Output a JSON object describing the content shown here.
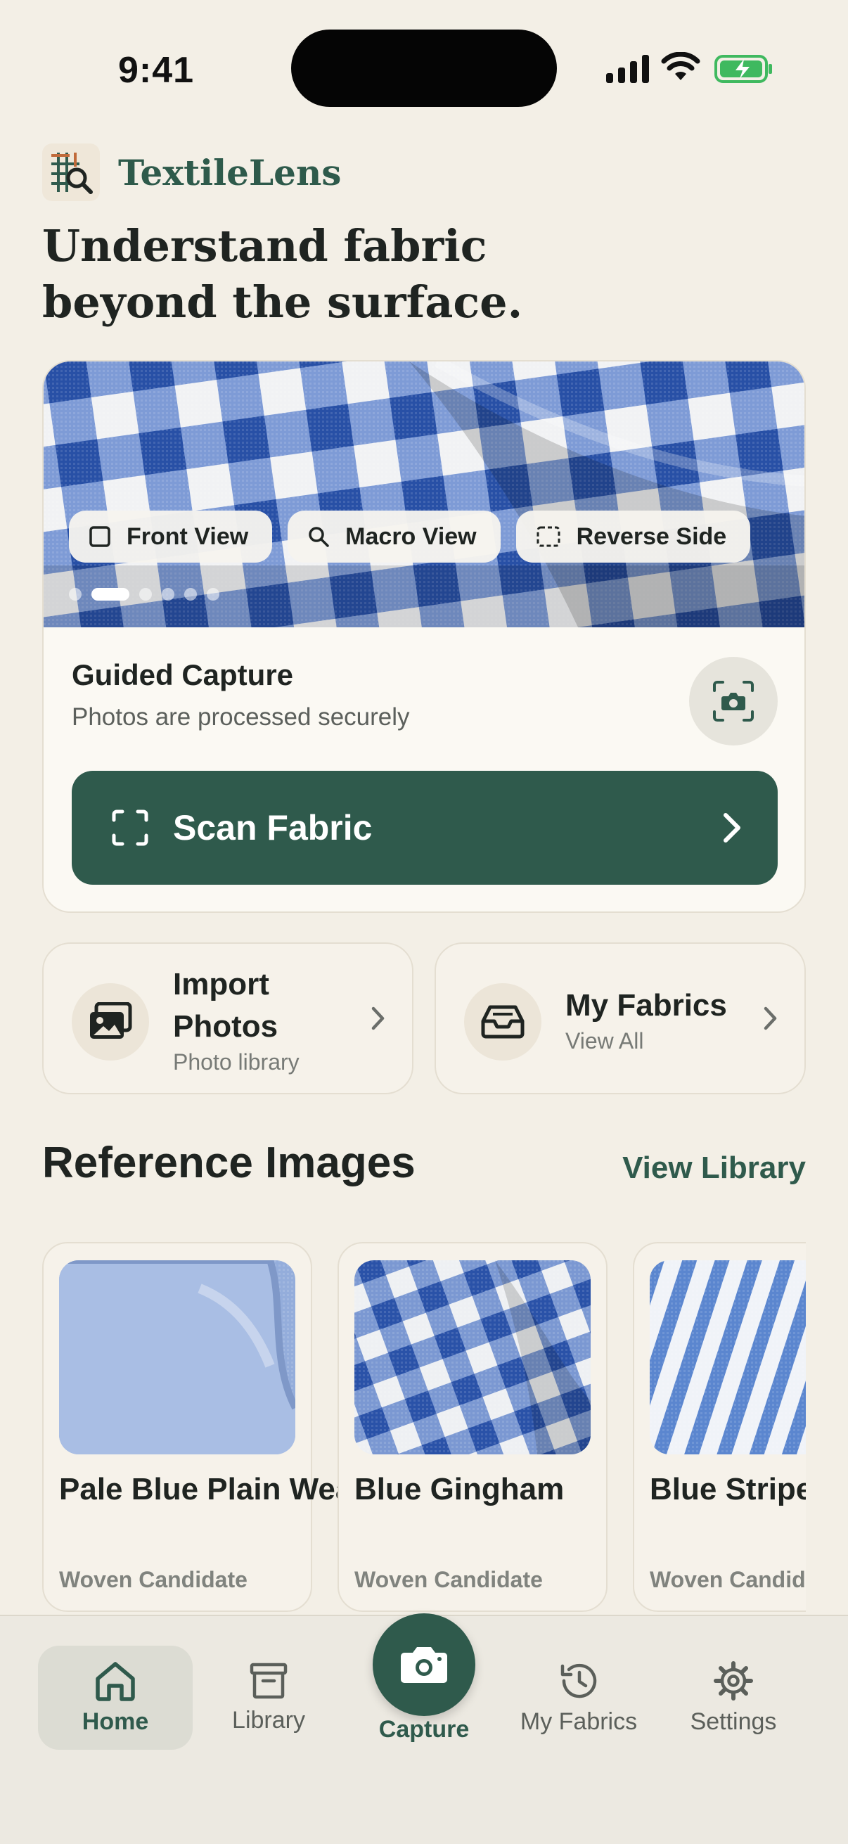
{
  "status_bar": {
    "time": "9:41"
  },
  "app": {
    "name": "TextileLens"
  },
  "headline": "Understand fabric beyond the surface.",
  "guided_card": {
    "chips": [
      {
        "label": "Front View",
        "icon": "square-icon"
      },
      {
        "label": "Macro View",
        "icon": "search-icon"
      },
      {
        "label": "Reverse Side",
        "icon": "dashed-square-icon"
      }
    ],
    "carousel_pages": 6,
    "carousel_active": 2,
    "title": "Guided Capture",
    "subtitle": "Photos are processed securely",
    "scan_button": "Scan Fabric"
  },
  "quick_actions": [
    {
      "title": "Import Photos",
      "subtitle": "Photo library",
      "icon": "photos-icon"
    },
    {
      "title": "My Fabrics",
      "subtitle": "View All",
      "icon": "inbox-icon"
    }
  ],
  "reference_section": {
    "title": "Reference Images",
    "link": "View Library",
    "items": [
      {
        "name": "Pale Blue Plain Weave",
        "kind": "Woven Candidate"
      },
      {
        "name": "Blue Gingham",
        "kind": "Woven Candidate"
      },
      {
        "name": "Blue Stripe Plain Weave",
        "kind": "Woven Candidate"
      }
    ]
  },
  "tab_bar": {
    "items": [
      {
        "label": "Home",
        "icon": "house-icon",
        "active": true
      },
      {
        "label": "Library",
        "icon": "archive-icon"
      },
      {
        "label": "Capture",
        "icon": "camera-icon"
      },
      {
        "label": "My Fabrics",
        "icon": "history-icon"
      },
      {
        "label": "Settings",
        "icon": "gear-icon"
      }
    ]
  },
  "colors": {
    "brand": "#2f5a4c",
    "background": "#f3efe6",
    "fabric_blue": "#2f5bb5"
  }
}
